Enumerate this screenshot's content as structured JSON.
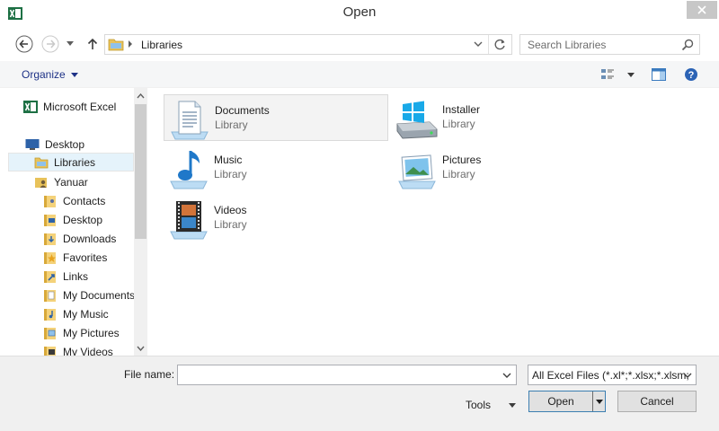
{
  "window": {
    "title": "Open"
  },
  "address": {
    "crumbs": [
      "Libraries"
    ]
  },
  "search": {
    "placeholder": "Search Libraries"
  },
  "toolbar": {
    "organize_label": "Organize"
  },
  "nav": {
    "items": [
      {
        "label": "Microsoft Excel",
        "icon": "excel-icon"
      },
      {
        "label": "Desktop",
        "icon": "desktop-icon"
      },
      {
        "label": "Libraries",
        "icon": "libraries-icon"
      },
      {
        "label": "Yanuar",
        "icon": "user-folder-icon"
      },
      {
        "label": "Contacts",
        "icon": "contacts-folder-icon"
      },
      {
        "label": "Desktop",
        "icon": "desktop-folder-icon"
      },
      {
        "label": "Downloads",
        "icon": "downloads-folder-icon"
      },
      {
        "label": "Favorites",
        "icon": "favorites-folder-icon"
      },
      {
        "label": "Links",
        "icon": "links-folder-icon"
      },
      {
        "label": "My Documents",
        "icon": "documents-folder-icon"
      },
      {
        "label": "My Music",
        "icon": "music-folder-icon"
      },
      {
        "label": "My Pictures",
        "icon": "pictures-folder-icon"
      },
      {
        "label": "My Videos",
        "icon": "videos-folder-icon"
      }
    ]
  },
  "libraries": [
    {
      "name": "Documents",
      "kind": "Library",
      "icon": "documents-library-icon"
    },
    {
      "name": "Installer",
      "kind": "Library",
      "icon": "installer-library-icon"
    },
    {
      "name": "Music",
      "kind": "Library",
      "icon": "music-library-icon"
    },
    {
      "name": "Pictures",
      "kind": "Library",
      "icon": "pictures-library-icon"
    },
    {
      "name": "Videos",
      "kind": "Library",
      "icon": "videos-library-icon"
    }
  ],
  "footer": {
    "file_name_label": "File name:",
    "file_name_value": "",
    "filter_value": "All Excel Files (*.xl*;*.xlsx;*.xlsm;",
    "tools_label": "Tools",
    "open_label": "Open",
    "cancel_label": "Cancel"
  },
  "colors": {
    "accent": "#1e3287",
    "selection": "#e5f3fb",
    "excel_green": "#1d7044"
  }
}
